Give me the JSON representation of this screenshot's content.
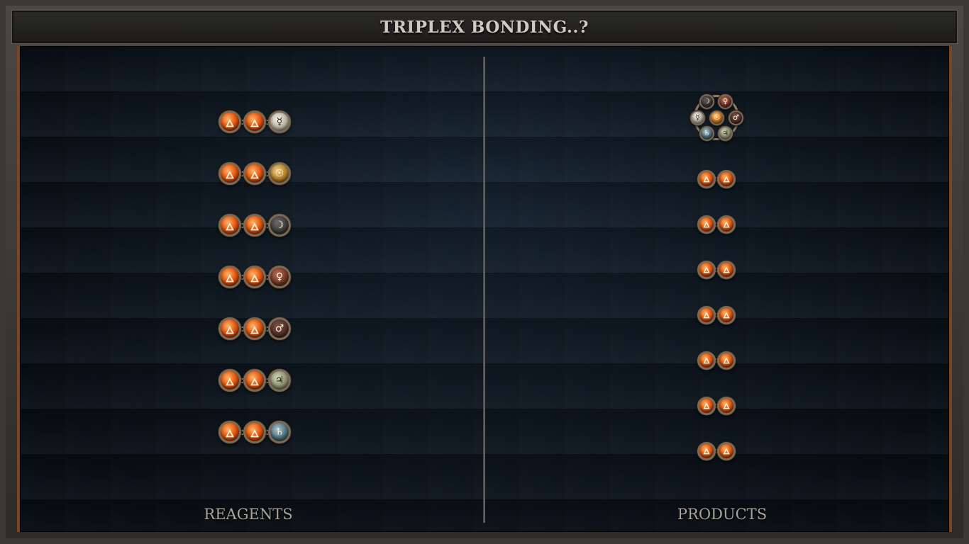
{
  "window": {
    "title": "TRIPLEX BONDING..?"
  },
  "columns": {
    "reagents_label": "REAGENTS",
    "products_label": "PRODUCTS"
  },
  "colors": {
    "board_background": "#0f1923",
    "frame_accent": "#7b4524",
    "fire_atom": "#e65a10",
    "title_text": "#cfc9c0"
  },
  "reagents": [
    {
      "atoms": [
        {
          "element": "fire",
          "symbol": "🜂"
        },
        {
          "element": "fire",
          "symbol": "🜂"
        },
        {
          "element": "silver",
          "symbol": "☿"
        }
      ]
    },
    {
      "atoms": [
        {
          "element": "fire",
          "symbol": "🜂"
        },
        {
          "element": "fire",
          "symbol": "🜂"
        },
        {
          "element": "gold",
          "symbol": "☉"
        }
      ]
    },
    {
      "atoms": [
        {
          "element": "fire",
          "symbol": "🜂"
        },
        {
          "element": "fire",
          "symbol": "🜂"
        },
        {
          "element": "moon",
          "symbol": "☽"
        }
      ]
    },
    {
      "atoms": [
        {
          "element": "fire",
          "symbol": "🜂"
        },
        {
          "element": "fire",
          "symbol": "🜂"
        },
        {
          "element": "venus",
          "symbol": "♀"
        }
      ]
    },
    {
      "atoms": [
        {
          "element": "fire",
          "symbol": "🜂"
        },
        {
          "element": "fire",
          "symbol": "🜂"
        },
        {
          "element": "mars",
          "symbol": "♂"
        }
      ]
    },
    {
      "atoms": [
        {
          "element": "fire",
          "symbol": "🜂"
        },
        {
          "element": "fire",
          "symbol": "🜂"
        },
        {
          "element": "jupiter",
          "symbol": "♃"
        }
      ]
    },
    {
      "atoms": [
        {
          "element": "fire",
          "symbol": "🜂"
        },
        {
          "element": "fire",
          "symbol": "🜂"
        },
        {
          "element": "saturn",
          "symbol": "♄"
        }
      ]
    }
  ],
  "products": {
    "cluster": {
      "center": {
        "element": "gold",
        "symbol": "☉"
      },
      "ring": [
        {
          "element": "moon",
          "symbol": "☽"
        },
        {
          "element": "venus",
          "symbol": "♀"
        },
        {
          "element": "mars",
          "symbol": "♂"
        },
        {
          "element": "jupiter",
          "symbol": "♃"
        },
        {
          "element": "saturn",
          "symbol": "♄"
        },
        {
          "element": "silver",
          "symbol": "☿"
        }
      ]
    },
    "pairs": [
      {
        "atoms": [
          {
            "element": "fire",
            "symbol": "🜂"
          },
          {
            "element": "fire",
            "symbol": "🜂"
          }
        ]
      },
      {
        "atoms": [
          {
            "element": "fire",
            "symbol": "🜂"
          },
          {
            "element": "fire",
            "symbol": "🜂"
          }
        ]
      },
      {
        "atoms": [
          {
            "element": "fire",
            "symbol": "🜂"
          },
          {
            "element": "fire",
            "symbol": "🜂"
          }
        ]
      },
      {
        "atoms": [
          {
            "element": "fire",
            "symbol": "🜂"
          },
          {
            "element": "fire",
            "symbol": "🜂"
          }
        ]
      },
      {
        "atoms": [
          {
            "element": "fire",
            "symbol": "🜂"
          },
          {
            "element": "fire",
            "symbol": "🜂"
          }
        ]
      },
      {
        "atoms": [
          {
            "element": "fire",
            "symbol": "🜂"
          },
          {
            "element": "fire",
            "symbol": "🜂"
          }
        ]
      },
      {
        "atoms": [
          {
            "element": "fire",
            "symbol": "🜂"
          },
          {
            "element": "fire",
            "symbol": "🜂"
          }
        ]
      }
    ]
  }
}
